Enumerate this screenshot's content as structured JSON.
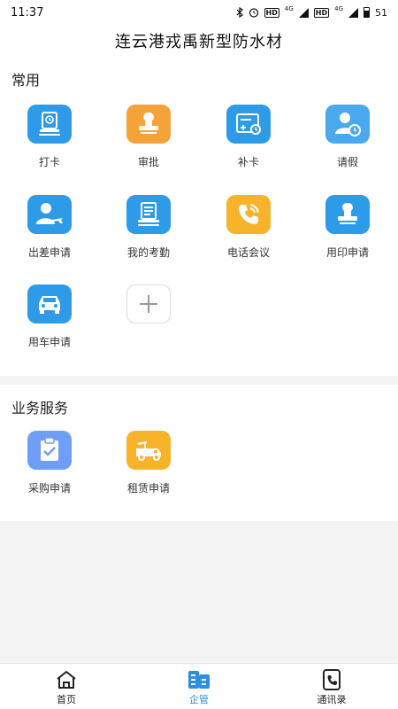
{
  "status_bar": {
    "time": "11:37",
    "battery": "51",
    "network_1": "4G",
    "network_2": "4G",
    "hd_1": "HD",
    "hd_2": "HD"
  },
  "header": {
    "title": "连云港戎禹新型防水材"
  },
  "sections": {
    "common": {
      "title": "常用",
      "items": [
        {
          "label": "打卡",
          "icon": "clock-in-icon"
        },
        {
          "label": "审批",
          "icon": "stamp-approval-icon"
        },
        {
          "label": "补卡",
          "icon": "card-add-icon"
        },
        {
          "label": "请假",
          "icon": "person-clock-icon"
        },
        {
          "label": "出差申请",
          "icon": "person-plane-icon"
        },
        {
          "label": "我的考勤",
          "icon": "attendance-icon"
        },
        {
          "label": "电话会议",
          "icon": "phone-call-icon"
        },
        {
          "label": "用印申请",
          "icon": "seal-icon"
        },
        {
          "label": "用车申请",
          "icon": "car-icon"
        }
      ],
      "add_icon": "plus-icon"
    },
    "business": {
      "title": "业务服务",
      "items": [
        {
          "label": "采购申请",
          "icon": "clipboard-check-icon"
        },
        {
          "label": "租赁申请",
          "icon": "crane-truck-icon"
        }
      ]
    }
  },
  "bottom_nav": {
    "items": [
      {
        "label": "首页",
        "icon": "home-icon",
        "active": false
      },
      {
        "label": "企管",
        "icon": "company-icon",
        "active": true
      },
      {
        "label": "通讯录",
        "icon": "phone-book-icon",
        "active": false
      }
    ]
  },
  "colors": {
    "primary_blue": "#2d9be8",
    "orange": "#f5a23a",
    "yellow": "#f7b42a",
    "lavender": "#6e9ef5",
    "nav_active": "#2d8fdf"
  }
}
